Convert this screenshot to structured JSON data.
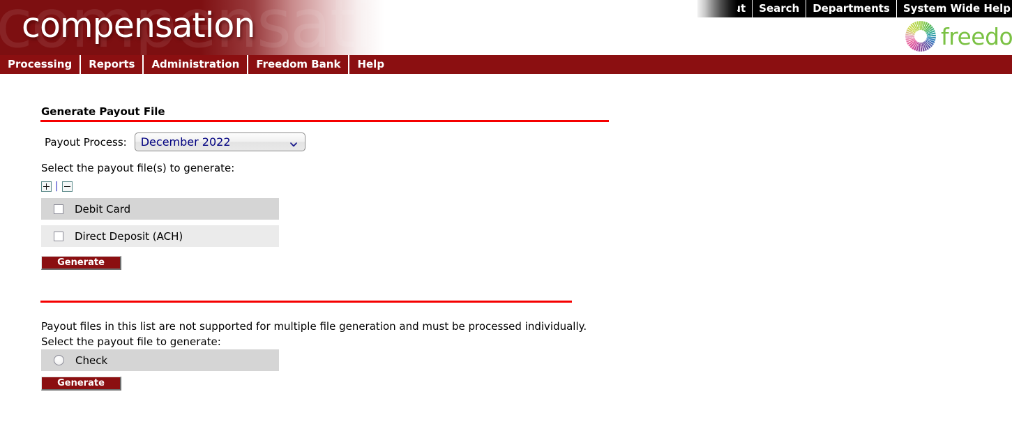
{
  "topbar": {
    "links": [
      {
        "label": "Logout",
        "name": "logout-link"
      },
      {
        "label": "Search",
        "name": "search-link"
      },
      {
        "label": "Departments",
        "name": "departments-link"
      },
      {
        "label": "System Wide Help",
        "name": "system-wide-help-link"
      }
    ]
  },
  "banner": {
    "wordmark": "compensation",
    "ghost_text": "compensation",
    "background_color": "#7d0f11"
  },
  "logo": {
    "text": "freedom",
    "text_color": "#7ac143",
    "mark": "sunburst-circle-icon"
  },
  "mainnav": {
    "background_color": "#8b0f11",
    "items": [
      {
        "label": "Processing",
        "name": "nav-item-processing"
      },
      {
        "label": "Reports",
        "name": "nav-item-reports"
      },
      {
        "label": "Administration",
        "name": "nav-item-administration"
      },
      {
        "label": "Freedom Bank",
        "name": "nav-item-freedom-bank"
      },
      {
        "label": "Help",
        "name": "nav-item-help"
      }
    ]
  },
  "main": {
    "page_title": "Generate Payout File",
    "rule_color": "#f50000",
    "payout_process": {
      "label": "Payout Process:",
      "selected": "December 2022",
      "options": [
        "December 2022"
      ],
      "text_color": "#000080"
    },
    "multi_section": {
      "instruction": "Select the payout file(s) to generate:",
      "expand_icon": "expand-plus-icon",
      "collapse_icon": "collapse-minus-icon",
      "separator": "|",
      "options": [
        {
          "label": "Debit Card",
          "checked": false
        },
        {
          "label": "Direct Deposit (ACH)",
          "checked": false
        }
      ],
      "generate_label": "Generate"
    },
    "single_section": {
      "note_line_1": "Payout files in this list are not supported for multiple file generation and must be processed individually.",
      "note_line_2": "Select the payout file to generate:",
      "options": [
        {
          "label": "Check",
          "selected": false
        }
      ],
      "generate_label": "Generate"
    }
  }
}
